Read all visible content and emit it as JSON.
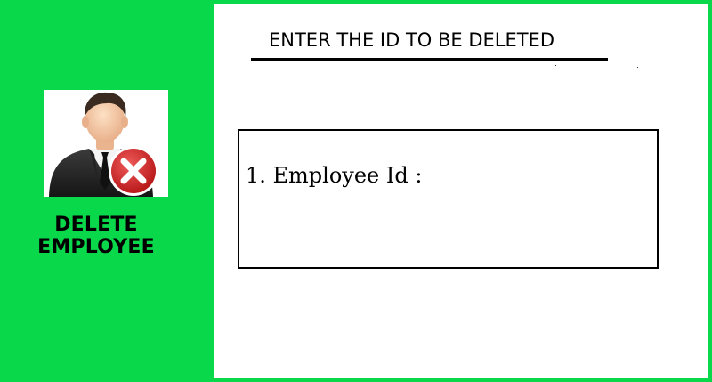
{
  "sidebar": {
    "title": "DELETE\nEMPLOYEE",
    "icon": "employee-delete-icon",
    "background_color": "#09d84a"
  },
  "main": {
    "heading": "ENTER THE ID TO BE DELETED",
    "form": {
      "field_label": "1. Employee Id :",
      "field_value": ""
    }
  }
}
